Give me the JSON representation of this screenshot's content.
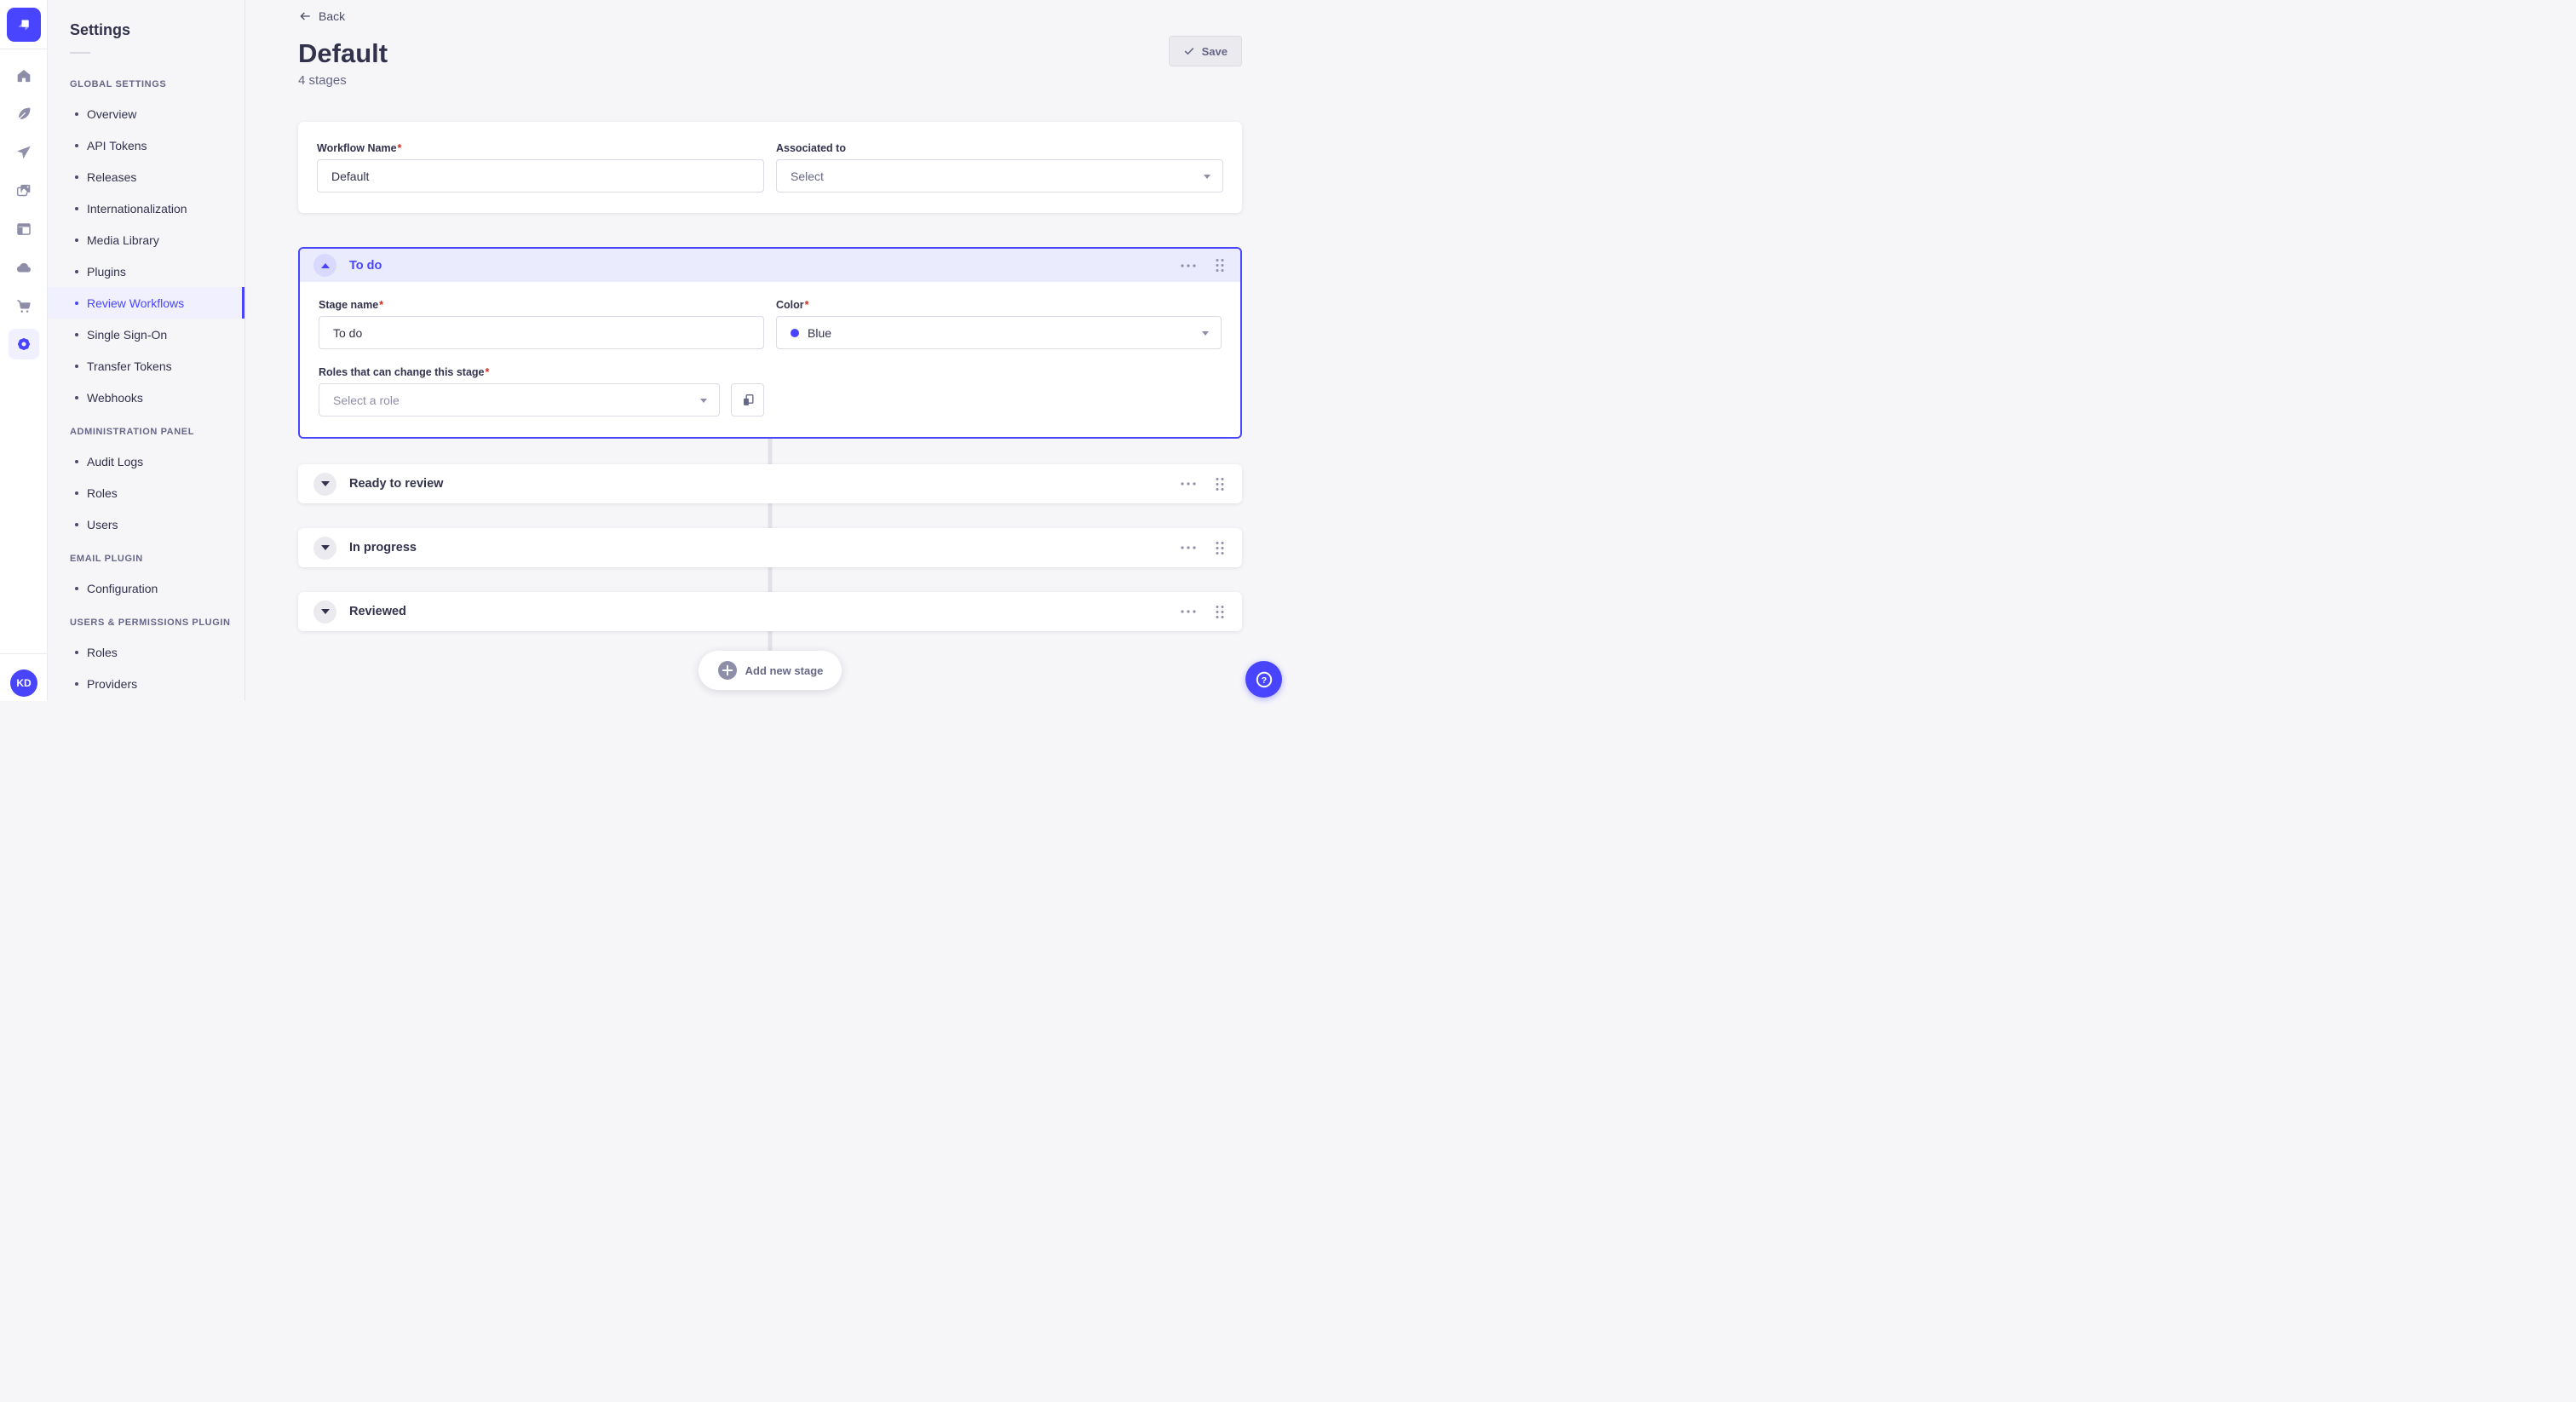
{
  "ui": {
    "required_mark": "*"
  },
  "nav_rail": {
    "logo_icon": "strapi-logo",
    "icons": [
      {
        "name": "home-icon"
      },
      {
        "name": "feather-icon"
      },
      {
        "name": "paper-plane-icon"
      },
      {
        "name": "media-library-icon"
      },
      {
        "name": "layout-icon"
      },
      {
        "name": "cloud-icon"
      },
      {
        "name": "cart-icon"
      },
      {
        "name": "settings-gear-icon",
        "active": true
      }
    ],
    "avatar_initials": "KD"
  },
  "sidebar": {
    "title": "Settings",
    "sections": [
      {
        "header": "GLOBAL SETTINGS",
        "items": [
          {
            "label": "Overview"
          },
          {
            "label": "API Tokens"
          },
          {
            "label": "Releases"
          },
          {
            "label": "Internationalization"
          },
          {
            "label": "Media Library"
          },
          {
            "label": "Plugins"
          },
          {
            "label": "Review Workflows",
            "selected": true
          },
          {
            "label": "Single Sign-On"
          },
          {
            "label": "Transfer Tokens"
          },
          {
            "label": "Webhooks"
          }
        ]
      },
      {
        "header": "ADMINISTRATION PANEL",
        "items": [
          {
            "label": "Audit Logs"
          },
          {
            "label": "Roles"
          },
          {
            "label": "Users"
          }
        ]
      },
      {
        "header": "EMAIL PLUGIN",
        "items": [
          {
            "label": "Configuration"
          }
        ]
      },
      {
        "header": "USERS & PERMISSIONS PLUGIN",
        "items": [
          {
            "label": "Roles"
          },
          {
            "label": "Providers"
          }
        ]
      }
    ]
  },
  "header": {
    "back_label": "Back",
    "title": "Default",
    "subtitle": "4 stages",
    "save_label": "Save"
  },
  "workflow_form": {
    "name_label": "Workflow Name",
    "name_value": "Default",
    "associated_label": "Associated to",
    "associated_placeholder": "Select"
  },
  "stage_editor": {
    "expanded_stage": {
      "title": "To do",
      "name_label": "Stage name",
      "name_value": "To do",
      "color_label": "Color",
      "color_value": "Blue",
      "color_hex": "#4945ff",
      "roles_label": "Roles that can change this stage",
      "roles_placeholder": "Select a role"
    },
    "collapsed_stages": [
      {
        "title": "Ready to review"
      },
      {
        "title": "In progress"
      },
      {
        "title": "Reviewed"
      }
    ],
    "add_stage_label": "Add new stage"
  },
  "colors": {
    "primary": "#4945ff",
    "primary_light": "#f0f0ff",
    "accordion_header": "#ebebfe",
    "danger": "#d02b20",
    "text": "#32324d",
    "muted": "#666687",
    "icon_gray": "#8e8ea9",
    "border": "#dcdce4",
    "background": "#f6f6f9"
  }
}
